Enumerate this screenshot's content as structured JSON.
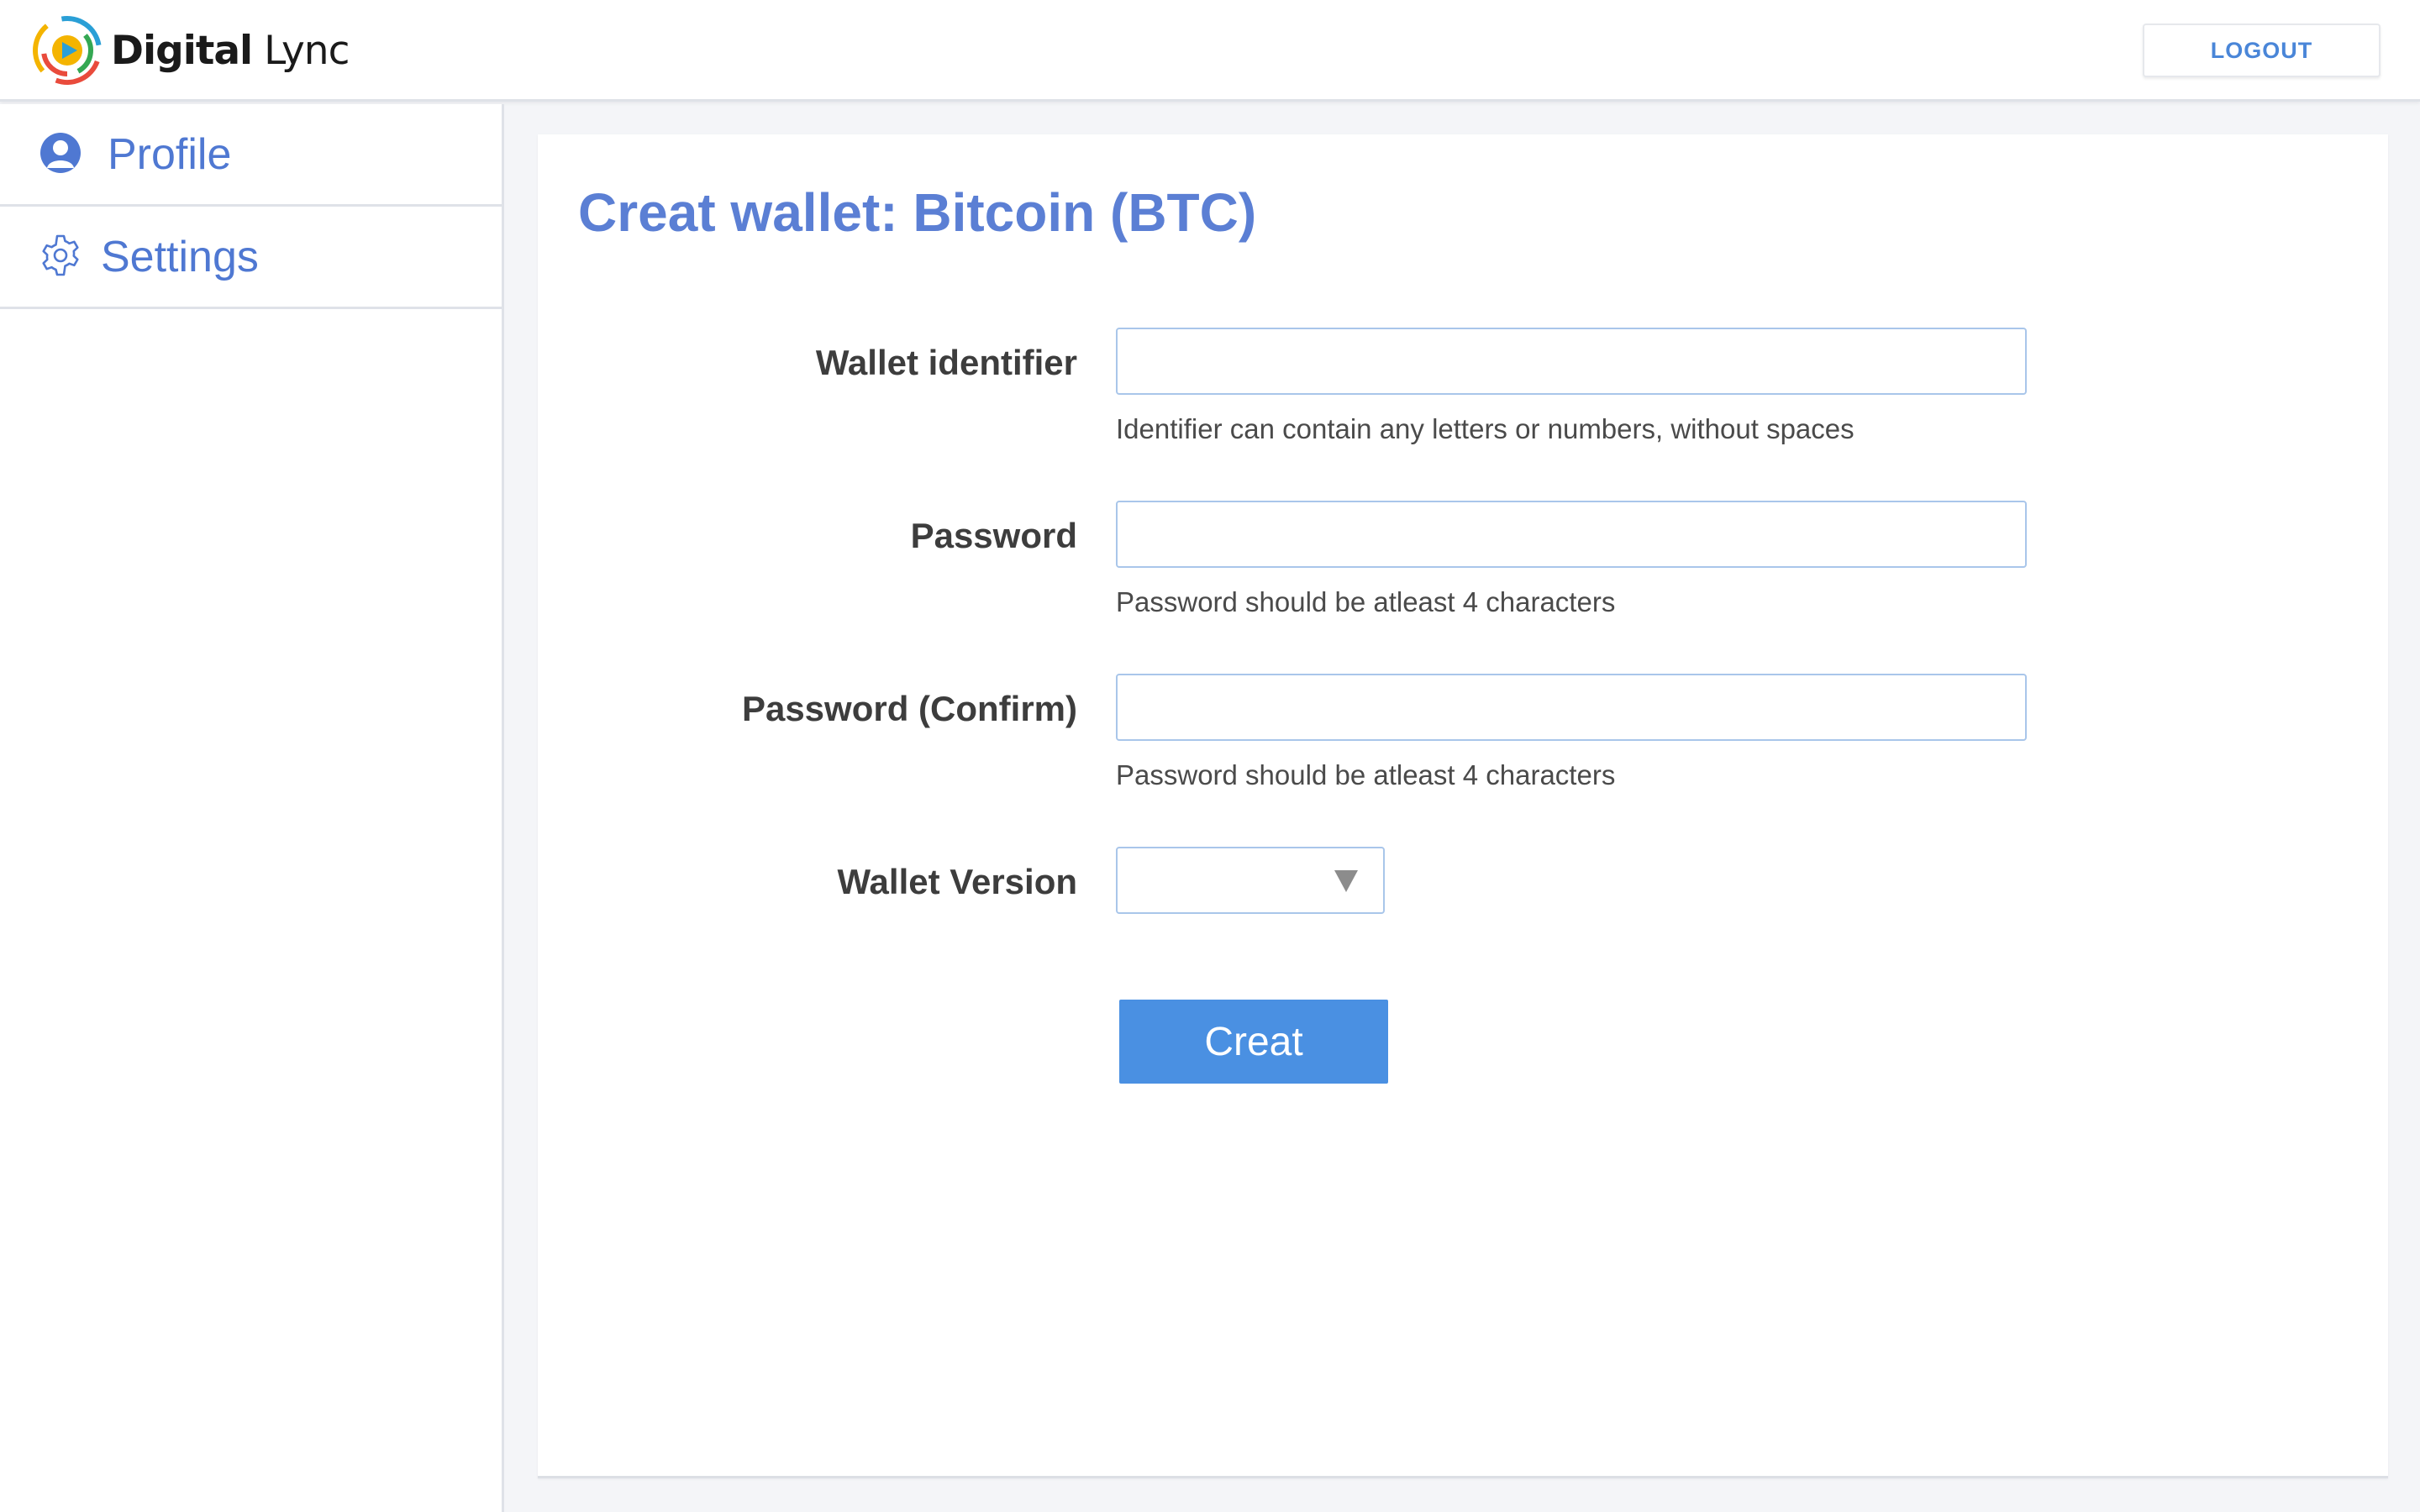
{
  "header": {
    "logo": {
      "brand_bold": "Digital",
      "brand_light": "Lync"
    },
    "logout_label": "LOGOUT"
  },
  "sidebar": {
    "items": [
      {
        "label": "Profile",
        "icon": "user-icon"
      },
      {
        "label": "Settings",
        "icon": "gear-icon"
      }
    ]
  },
  "main": {
    "title": "Creat wallet: Bitcoin (BTC)",
    "form": {
      "wallet_identifier": {
        "label": "Wallet identifier",
        "value": "",
        "help": "Identifier can contain any letters or numbers, without spaces"
      },
      "password": {
        "label": "Password",
        "value": "",
        "help": "Password should be atleast 4 characters"
      },
      "password_confirm": {
        "label": "Password (Confirm)",
        "value": "",
        "help": "Password should be atleast 4 characters"
      },
      "wallet_version": {
        "label": "Wallet Version",
        "selected": ""
      },
      "submit_label": "Creat"
    }
  },
  "colors": {
    "accent": "#4a90e2",
    "title": "#5b7fd4",
    "sidebar_text": "#4f78d2",
    "input_border": "#a9c6ea"
  }
}
